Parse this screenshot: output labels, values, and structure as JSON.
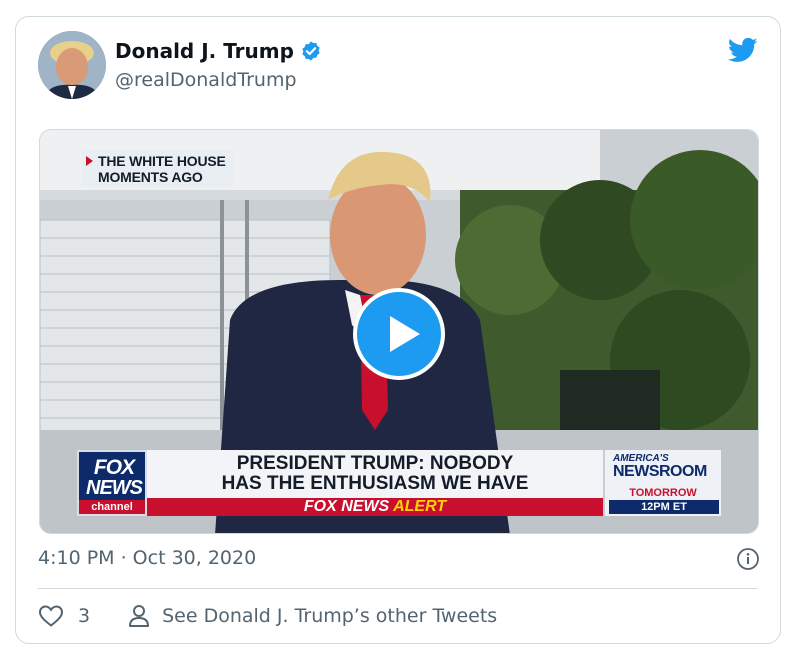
{
  "author": {
    "display_name": "Donald J. Trump",
    "handle": "@realDonaldTrump",
    "verified": true
  },
  "icons": {
    "platform": "twitter-bird-icon",
    "verified": "verified-badge-icon",
    "play": "play-icon",
    "info": "info-icon",
    "like": "heart-icon",
    "profile": "person-icon"
  },
  "colors": {
    "accent": "#1d9bf0",
    "text_primary": "#0f1419",
    "text_secondary": "#536471",
    "border": "#cfd9de"
  },
  "video": {
    "location_tag_line1": "THE WHITE HOUSE",
    "location_tag_line2": "MOMENTS AGO",
    "network_line1": "FOX",
    "network_line2": "NEWS",
    "network_line3": "channel",
    "headline_line1": "PRESIDENT TRUMP: NOBODY",
    "headline_line2": "HAS THE ENTHUSIASM WE HAVE",
    "alert_prefix": "FOX NEWS",
    "alert_word": "ALERT",
    "show_line1": "AMERICA'S",
    "show_line2": "NEWSROOM",
    "show_line3": "TOMORROW",
    "show_line4": "12PM ET"
  },
  "meta": {
    "timestamp": "4:10 PM · Oct 30, 2020"
  },
  "actions": {
    "like_count": "3",
    "profile_link": "See Donald J. Trump’s other Tweets"
  }
}
